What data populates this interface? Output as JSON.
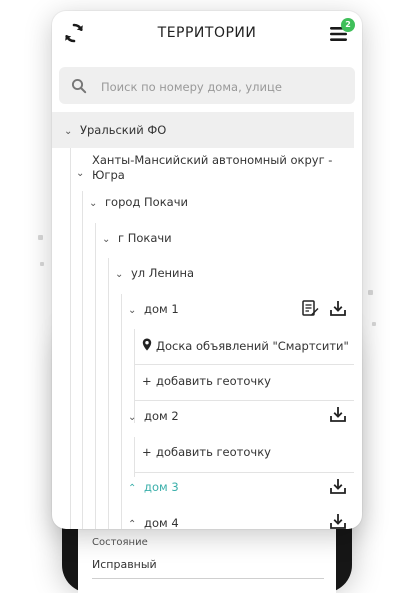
{
  "header": {
    "title": "ТЕРРИТОРИИ",
    "badge_count": "2"
  },
  "search": {
    "placeholder": "Поиск по номеру дома, улице",
    "value": ""
  },
  "tree": {
    "root": "Уральский ФО",
    "okrug_line1": "Ханты-Мансийский автономный округ -",
    "okrug_line2": "Югра",
    "city": "город Покачи",
    "locality": "г Покачи",
    "street": "ул Ленина",
    "houses": [
      {
        "label": "дом 1",
        "geo_point": "Доска объявлений \"Смартсити\"",
        "add_label": "добавить геоточку"
      },
      {
        "label": "дом 2",
        "add_label": "добавить геоточку"
      },
      {
        "label": "дом 3"
      },
      {
        "label": "дом 4"
      }
    ]
  },
  "background_form": {
    "field_label": "Состояние",
    "field_value": "Исправный"
  },
  "colors": {
    "accent": "#3aafaa",
    "badge": "#3fbf5a"
  }
}
